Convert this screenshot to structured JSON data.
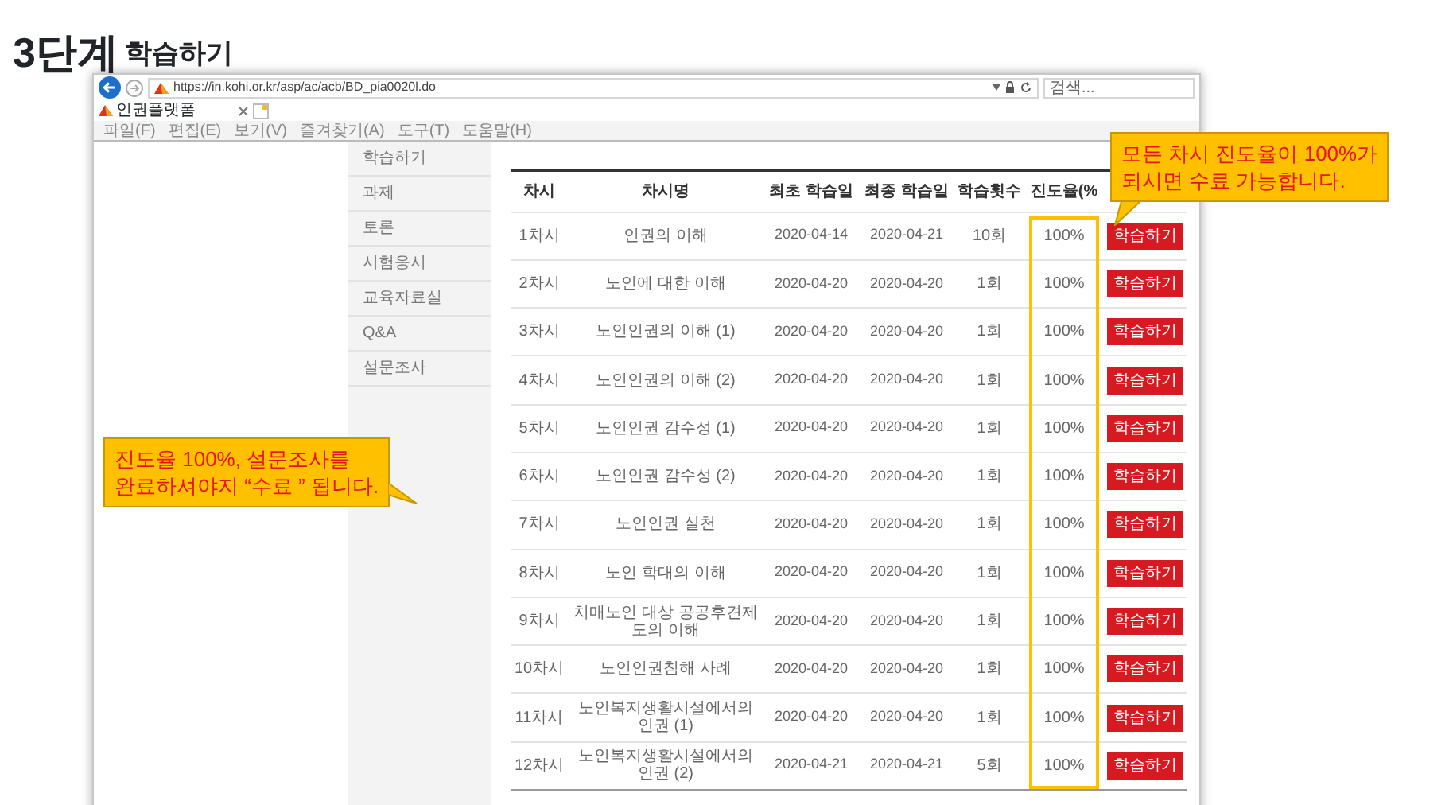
{
  "slide": {
    "step": "3단계",
    "title": "학습하기"
  },
  "browser": {
    "url": "https://in.kohi.or.kr/asp/ac/acb/BD_pia0020l.do",
    "search": {
      "placeholder": "검색..."
    },
    "tab": {
      "label": "인권플랫폼"
    },
    "menu": [
      "파일(F)",
      "편집(E)",
      "보기(V)",
      "즐겨찾기(A)",
      "도구(T)",
      "도움말(H)"
    ]
  },
  "sidebar": {
    "items": [
      {
        "label": "학습하기"
      },
      {
        "label": "과제"
      },
      {
        "label": "토론"
      },
      {
        "label": "시험응시"
      },
      {
        "label": "교육자료실"
      },
      {
        "label": "Q&A"
      },
      {
        "label": "설문조사"
      }
    ]
  },
  "table": {
    "columns": [
      {
        "label": "차시"
      },
      {
        "label": "차시명"
      },
      {
        "label": "최초 학습일"
      },
      {
        "label": "최종 학습일"
      },
      {
        "label": "학습횟수"
      },
      {
        "label": "진도율(%"
      }
    ],
    "progress_frame": true,
    "rows": [
      {
        "cells": [
          "1차시",
          "인권의 이해",
          "2020-04-14",
          "2020-04-21",
          "10회",
          "100%"
        ],
        "button": "학습하기"
      },
      {
        "cells": [
          "2차시",
          "노인에 대한 이해",
          "2020-04-20",
          "2020-04-20",
          "1회",
          "100%"
        ],
        "button": "학습하기"
      },
      {
        "cells": [
          "3차시",
          "노인인권의 이해 (1)",
          "2020-04-20",
          "2020-04-20",
          "1회",
          "100%"
        ],
        "button": "학습하기"
      },
      {
        "cells": [
          "4차시",
          "노인인권의 이해 (2)",
          "2020-04-20",
          "2020-04-20",
          "1회",
          "100%"
        ],
        "button": "학습하기"
      },
      {
        "cells": [
          "5차시",
          "노인인권 감수성 (1)",
          "2020-04-20",
          "2020-04-20",
          "1회",
          "100%"
        ],
        "button": "학습하기"
      },
      {
        "cells": [
          "6차시",
          "노인인권 감수성 (2)",
          "2020-04-20",
          "2020-04-20",
          "1회",
          "100%"
        ],
        "button": "학습하기"
      },
      {
        "cells": [
          "7차시",
          "노인인권 실천",
          "2020-04-20",
          "2020-04-20",
          "1회",
          "100%"
        ],
        "button": "학습하기"
      },
      {
        "cells": [
          "8차시",
          "노인 학대의 이해",
          "2020-04-20",
          "2020-04-20",
          "1회",
          "100%"
        ],
        "button": "학습하기"
      },
      {
        "cells": [
          "9차시",
          "치매노인 대상 공공후견제도의 이해",
          "2020-04-20",
          "2020-04-20",
          "1회",
          "100%"
        ],
        "button": "학습하기"
      },
      {
        "cells": [
          "10차시",
          "노인인권침해 사례",
          "2020-04-20",
          "2020-04-20",
          "1회",
          "100%"
        ],
        "button": "학습하기"
      },
      {
        "cells": [
          "11차시",
          "노인복지생활시설에서의 인권 (1)",
          "2020-04-20",
          "2020-04-20",
          "1회",
          "100%"
        ],
        "button": "학습하기"
      },
      {
        "cells": [
          "12차시",
          "노인복지생활시설에서의 인권 (2)",
          "2020-04-21",
          "2020-04-21",
          "5회",
          "100%"
        ],
        "button": "학습하기"
      }
    ]
  },
  "callouts": [
    {
      "kind": "progress-note",
      "lines": [
        "모든 차시 진도율이 100%가",
        "되시면 수료 가능합니다."
      ]
    },
    {
      "kind": "survey-note",
      "lines": [
        "진도율 100%, 설문조사를",
        "완료하셔야지 “수료 ” 됩니다."
      ]
    }
  ]
}
